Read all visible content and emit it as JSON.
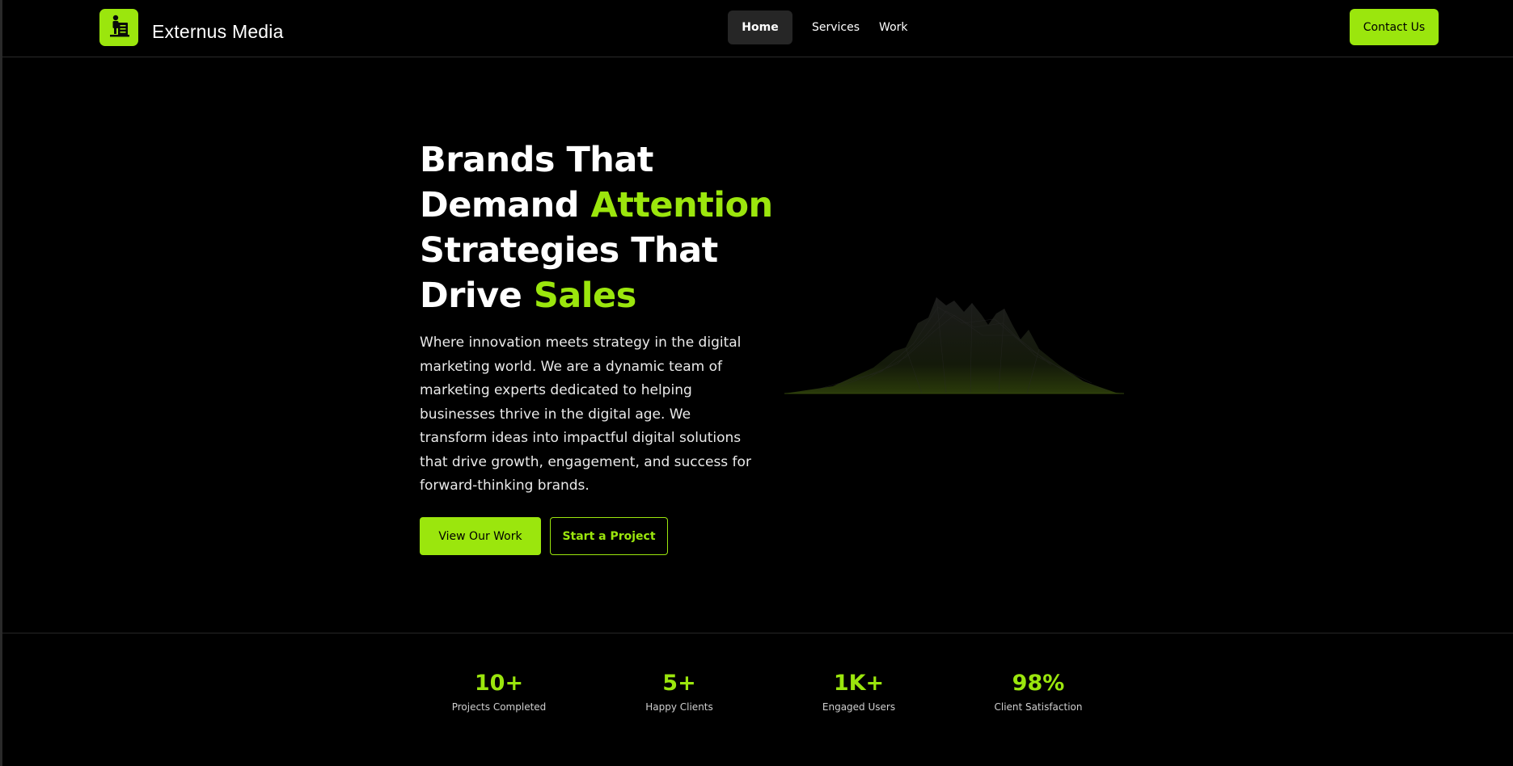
{
  "header": {
    "logo_icon": "podium-speaker-icon",
    "brand_name": "Externus Media",
    "nav": [
      {
        "label": "Home",
        "active": true
      },
      {
        "label": "Services",
        "active": false
      },
      {
        "label": "Work",
        "active": false
      }
    ],
    "contact_label": "Contact Us"
  },
  "hero": {
    "title_line1": "Brands That",
    "title_line2_a": "Demand ",
    "title_line2_b": "Attention",
    "title_line3": "Strategies That",
    "title_line4_a": "Drive ",
    "title_line4_b": "Sales",
    "description": "Where innovation meets strategy in the digital marketing world. We are a dynamic team of marketing experts dedicated to helping businesses thrive in the digital age. We transform ideas into impactful digital solutions that drive growth, engagement, and success for forward-thinking brands.",
    "primary_button": "View Our Work",
    "secondary_button": "Start a Project",
    "graphic_icon": "mountain-wireframe-graphic"
  },
  "stats": [
    {
      "value": "10+",
      "label": "Projects Completed"
    },
    {
      "value": "5+",
      "label": "Happy Clients"
    },
    {
      "value": "1K+",
      "label": "Engaged Users"
    },
    {
      "value": "98%",
      "label": "Client Satisfaction"
    }
  ],
  "colors": {
    "accent": "#9be60d",
    "background": "#000000",
    "nav_active_bg": "#262626"
  }
}
